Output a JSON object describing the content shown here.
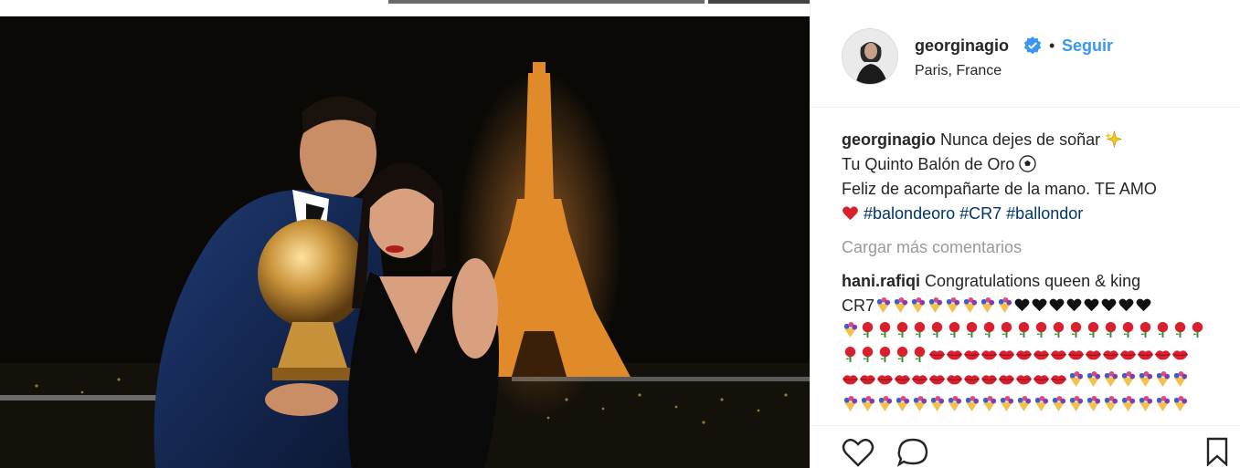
{
  "post": {
    "username": "georginagio",
    "separator": "•",
    "follow_label": "Seguir",
    "location": "Paris, France"
  },
  "caption": {
    "username": "georginagio",
    "line1": "Nunca dejes de soñar",
    "line2": "Tu Quinto Balón de Oro",
    "line3": "Feliz de acompañarte de la mano. TE AMO",
    "hashtags": [
      "#balondeoro",
      "#CR7",
      "#ballondor"
    ]
  },
  "load_more_label": "Cargar más comentarios",
  "comment": {
    "username": "hani.rafiqi",
    "text": "Congratulations queen & king",
    "text2": "CR7"
  },
  "icons": {
    "verified": "verified-badge-icon",
    "sparkle": "sparkles-icon",
    "ball": "soccer-ball-icon",
    "heart_emoji": "red-heart-icon",
    "like": "heart-icon",
    "comment": "comment-icon",
    "save": "bookmark-icon"
  },
  "colors": {
    "link_blue": "#3897f0",
    "hashtag": "#003569",
    "muted": "#999999",
    "text": "#262626"
  }
}
